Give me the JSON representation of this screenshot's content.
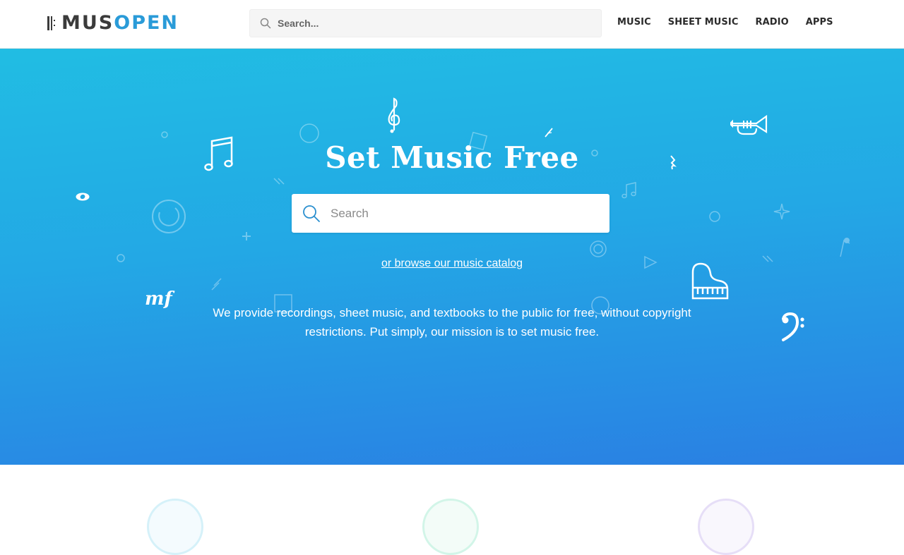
{
  "header": {
    "logo": {
      "part1": "MUS",
      "part2": "OPEN"
    },
    "search": {
      "placeholder": "Search..."
    },
    "nav": [
      {
        "label": "MUSIC"
      },
      {
        "label": "SHEET MUSIC"
      },
      {
        "label": "RADIO"
      },
      {
        "label": "APPS"
      }
    ]
  },
  "hero": {
    "title": "Set Music Free",
    "search_placeholder": "Search",
    "browse_link": "or browse our music catalog",
    "mission": "We provide recordings, sheet music, and textbooks to the public for free, without copyright restrictions. Put simply, our mission is to set music free.",
    "decorations": {
      "dynamics_mark": "mf",
      "icons": [
        "treble-clef-icon",
        "music-notes-icon",
        "trumpet-icon",
        "piano-icon",
        "bass-clef-icon",
        "whole-note-icon",
        "quarter-rest-icon"
      ]
    }
  },
  "features": {
    "circle_colors": [
      "#8fd8ec",
      "#8fe6c8",
      "#c7b8ea"
    ]
  },
  "colors": {
    "brand_dark": "#3b3b3b",
    "brand_accent": "#2a9bd8",
    "hero_gradient_top": "#21bde3",
    "hero_gradient_bottom": "#2a7fe3"
  }
}
